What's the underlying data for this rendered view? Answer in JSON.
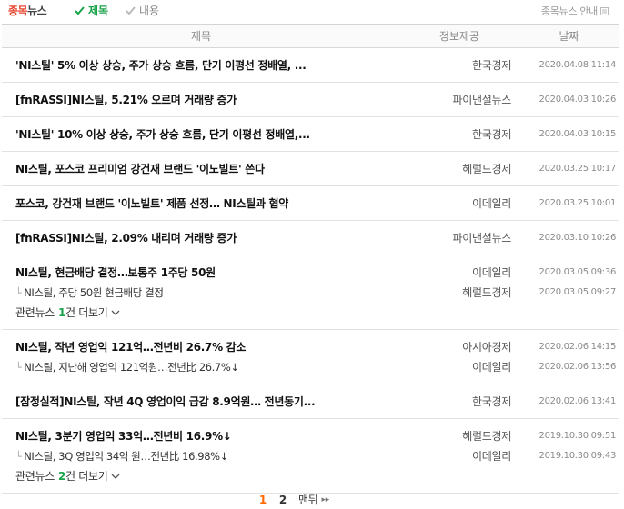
{
  "header": {
    "brand_part1": "종목",
    "brand_part2": "뉴스",
    "filter_title": "제목",
    "filter_body": "내용",
    "guide_label": "종목뉴스 안내"
  },
  "columns": {
    "title": "제목",
    "source": "정보제공",
    "date": "날짜"
  },
  "rows": [
    {
      "title": "'NI스틸' 5% 이상 상승, 주가 상승 흐름, 단기 이평선 정배열, ...",
      "source": "한국경제",
      "date": "2020.04.08 11:14"
    },
    {
      "title": "[fnRASSI]NI스틸, 5.21% 오르며 거래량 증가",
      "source": "파이낸셜뉴스",
      "date": "2020.04.03 10:26"
    },
    {
      "title": "'NI스틸' 10% 이상 상승, 주가 상승 흐름, 단기 이평선 정배열,...",
      "source": "한국경제",
      "date": "2020.04.03 10:15"
    },
    {
      "title": "NI스틸, 포스코 프리미엄 강건재 브랜드 '이노빌트' 쓴다",
      "source": "헤럴드경제",
      "date": "2020.03.25 10:17"
    },
    {
      "title": "포스코, 강건재 브랜드 '이노빌트' 제품 선정… NI스틸과 협약",
      "source": "이데일리",
      "date": "2020.03.25 10:01"
    },
    {
      "title": "[fnRASSI]NI스틸, 2.09% 내리며 거래량 증가",
      "source": "파이낸셜뉴스",
      "date": "2020.03.10 10:26"
    },
    {
      "title": "NI스틸, 현금배당 결정…보통주 1주당 50원",
      "source": "이데일리",
      "date": "2020.03.05 09:36",
      "sub_title": "NI스틸, 주당 50원 현금배당 결정",
      "sub_source": "헤럴드경제",
      "sub_date": "2020.03.05 09:27",
      "related_label": "관련뉴스",
      "related_count": "1",
      "related_suffix": "건 더보기"
    },
    {
      "title": "NI스틸, 작년 영업익 121억…전년비 26.7% 감소",
      "source": "아시아경제",
      "date": "2020.02.06 14:15",
      "sub_title": "NI스틸, 지난해 영업익 121억원…전년比 26.7%↓",
      "sub_source": "이데일리",
      "sub_date": "2020.02.06 13:56"
    },
    {
      "title": "[잠정실적]NI스틸, 작년 4Q 영업이익 급감 8.9억원… 전년동기...",
      "source": "한국경제",
      "date": "2020.02.06 13:41"
    },
    {
      "title": "NI스틸, 3분기 영업익 33억…전년비 16.9%↓",
      "source": "헤럴드경제",
      "date": "2019.10.30 09:51",
      "sub_title": "NI스틸, 3Q 영업익 34억 원…전년比 16.98%↓",
      "sub_source": "이데일리",
      "sub_date": "2019.10.30 09:43",
      "related_label": "관련뉴스",
      "related_count": "2",
      "related_suffix": "건 더보기"
    }
  ],
  "pagination": {
    "page1": "1",
    "page2": "2",
    "last_label": "맨뒤",
    "last_arrow": "▸▸"
  },
  "colors": {
    "accent_green": "#19a34a",
    "brand_red": "#e8442e",
    "current_page": "#ff6a00"
  },
  "icons": {
    "filter_check": "check-icon",
    "related_more": "chevron-down-icon",
    "guide": "info-box-icon"
  }
}
